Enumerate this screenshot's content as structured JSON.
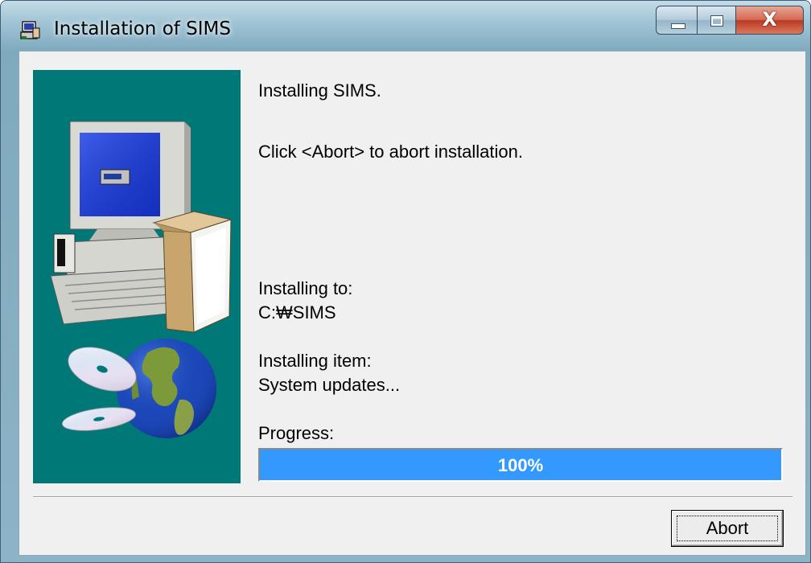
{
  "window": {
    "title": "Installation of SIMS",
    "icon": "installer-app-icon",
    "controls": {
      "minimize_icon": "minimize-icon",
      "maximize_icon": "maximize-icon",
      "close_label": "X"
    }
  },
  "messages": {
    "line1": "Installing SIMS.",
    "line2": "Click <Abort> to abort installation.",
    "installing_to_label": "Installing to:",
    "installing_to_value": "C:₩SIMS",
    "installing_item_label": "Installing item:",
    "installing_item_value": "System updates...",
    "progress_label": "Progress:"
  },
  "progress": {
    "percent": 100,
    "text": "100%"
  },
  "buttons": {
    "abort_label": "Abort"
  },
  "colors": {
    "side_panel": "#007878",
    "progress_fill": "#3399ff",
    "dialog_background": "#f0f0f0"
  },
  "illustration": {
    "icons": [
      "computer-icon",
      "software-box-icon",
      "cd-disc-icon",
      "globe-icon"
    ]
  }
}
